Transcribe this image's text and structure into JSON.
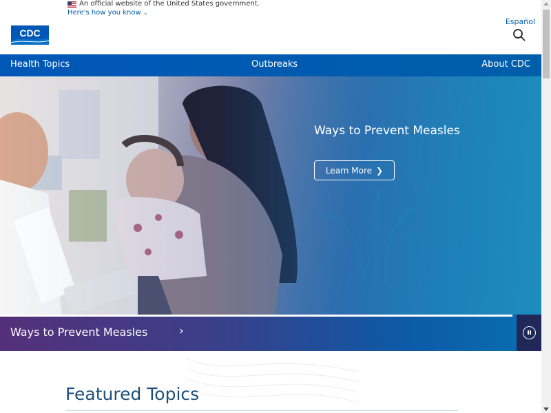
{
  "gov_banner": {
    "text": "An official website of the United States government.",
    "link": "Here's how you know"
  },
  "header": {
    "logo_text": "CDC",
    "language_link": "Español",
    "search_icon": "search-icon"
  },
  "nav": {
    "items": [
      {
        "label": "Health Topics"
      },
      {
        "label": "Outbreaks"
      },
      {
        "label": "About CDC"
      }
    ]
  },
  "hero": {
    "heading": "Ways to Prevent Measles",
    "cta_label": "Learn More"
  },
  "carousel": {
    "title": "Ways to Prevent Measles",
    "pause_icon": "pause-icon"
  },
  "featured": {
    "title": "Featured Topics"
  },
  "colors": {
    "nav_blue": "#005eaa",
    "strip_purple": "#55307a",
    "featured_title": "#1d4f7a"
  }
}
